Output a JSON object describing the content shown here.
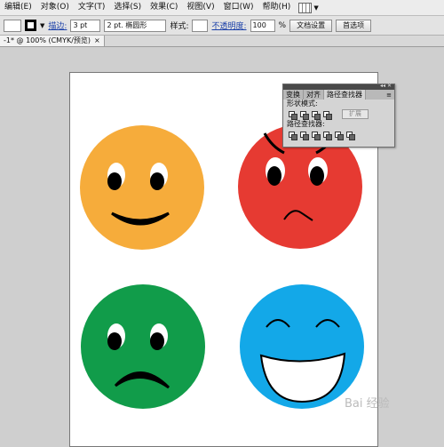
{
  "menubar": {
    "items": [
      "编辑(E)",
      "对象(O)",
      "文字(T)",
      "选择(S)",
      "效果(C)",
      "视图(V)",
      "窗口(W)",
      "帮助(H)"
    ]
  },
  "controlbar": {
    "stroke_label": "描边:",
    "stroke_weight": "3 pt",
    "brush_value": "2 pt. 椭圆形",
    "style_label": "样式:",
    "opacity_label": "不透明度:",
    "opacity_value": "100",
    "percent": "%",
    "doc_setup": "文档设置",
    "preferences": "首选项"
  },
  "document_tab": {
    "label": "-1* @ 100% (CMYK/预览)",
    "close": "×"
  },
  "panel": {
    "tabs": [
      "变换",
      "对齐",
      "路径查找器"
    ],
    "shape_modes_label": "形状模式:",
    "expand_label": "扩展",
    "pathfinders_label": "路径查找器:"
  },
  "faces": [
    {
      "name": "happy",
      "color": "#f6ac3b"
    },
    {
      "name": "angry",
      "color": "#e63a32"
    },
    {
      "name": "sad",
      "color": "#119c4a"
    },
    {
      "name": "laughing",
      "color": "#13a8e8"
    }
  ],
  "watermark": "Bai 经验"
}
